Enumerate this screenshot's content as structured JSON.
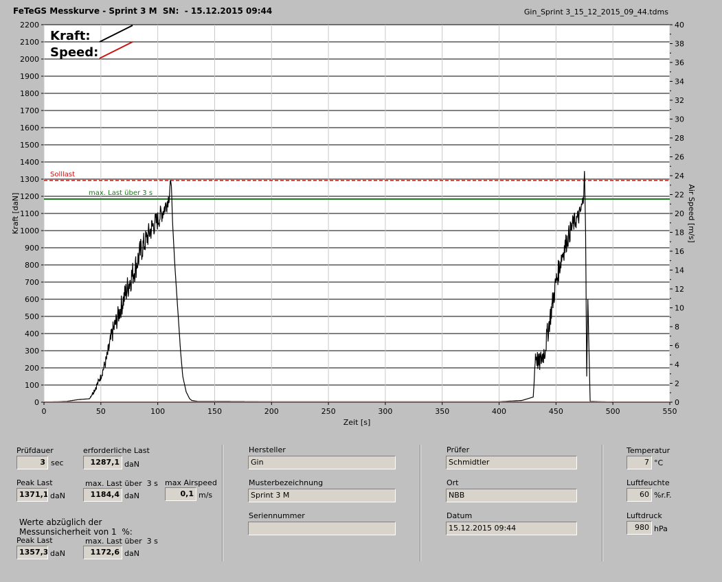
{
  "header": {
    "title": "FeTeGS Messkurve - Sprint 3 M  SN:  - 15.12.2015 09:44",
    "file": "Gin_Sprint 3_15_12_2015_09_44.tdms"
  },
  "chart_data": {
    "type": "line",
    "xlabel": "Zeit [s]",
    "ylabel": "Kraft [daN]",
    "y2label": "Air Speed [m/s]",
    "xlim": [
      0,
      550
    ],
    "ylim": [
      0,
      2200
    ],
    "y2lim": [
      0,
      40
    ],
    "x_ticks": [
      "0",
      "50",
      "100",
      "150",
      "200",
      "250",
      "300",
      "350",
      "400",
      "450",
      "500",
      "550"
    ],
    "y_ticks": [
      "0",
      "100",
      "200",
      "300",
      "400",
      "500",
      "600",
      "700",
      "800",
      "900",
      "1000",
      "1100",
      "1200",
      "1300",
      "1400",
      "1500",
      "1600",
      "1700",
      "1800",
      "1900",
      "2000",
      "2100",
      "2200"
    ],
    "y2_ticks": [
      "0",
      "2",
      "4",
      "6",
      "8",
      "10",
      "12",
      "14",
      "16",
      "18",
      "20",
      "22",
      "24",
      "26",
      "28",
      "30",
      "32",
      "34",
      "36",
      "38",
      "40"
    ],
    "grid": true,
    "legend": [
      {
        "name": "Kraft:",
        "color": "#000000"
      },
      {
        "name": "Speed:",
        "color": "#cc1111"
      }
    ],
    "annotations": [
      {
        "label": "Solllast",
        "y": 1292,
        "color": "#cc1111",
        "style": "dashed"
      },
      {
        "label": "max. Last über  3 s",
        "y": 1184,
        "color": "#1a7a1a",
        "style": "solid"
      }
    ],
    "series": [
      {
        "name": "Kraft",
        "color": "#000000",
        "x": [
          0,
          20,
          30,
          40,
          45,
          48,
          50,
          55,
          60,
          65,
          70,
          75,
          80,
          85,
          90,
          95,
          100,
          105,
          108,
          110,
          111,
          112,
          113,
          115,
          118,
          120,
          122,
          125,
          128,
          130,
          135,
          140,
          200,
          300,
          400,
          420,
          430,
          432,
          435,
          440,
          445,
          450,
          455,
          460,
          465,
          470,
          472,
          474,
          475,
          476,
          477,
          478,
          480,
          490,
          500
        ],
        "y": [
          0,
          5,
          15,
          20,
          80,
          120,
          150,
          250,
          400,
          500,
          600,
          700,
          780,
          880,
          950,
          1020,
          1060,
          1120,
          1160,
          1200,
          1280,
          1260,
          1050,
          800,
          500,
          300,
          150,
          60,
          20,
          10,
          5,
          5,
          3,
          3,
          3,
          10,
          30,
          280,
          220,
          300,
          500,
          700,
          850,
          950,
          1040,
          1080,
          1120,
          1180,
          1360,
          1000,
          150,
          600,
          5,
          3,
          0
        ],
        "noise": [
          0,
          0,
          0,
          0,
          20,
          20,
          20,
          40,
          60,
          60,
          70,
          80,
          80,
          80,
          70,
          70,
          60,
          60,
          50,
          40,
          30,
          0,
          0,
          0,
          0,
          0,
          0,
          0,
          0,
          0,
          0,
          0,
          0,
          0,
          0,
          0,
          0,
          60,
          60,
          70,
          70,
          70,
          70,
          60,
          60,
          50,
          50,
          50,
          20,
          0,
          0,
          0,
          0,
          0,
          0
        ]
      },
      {
        "name": "Speed",
        "color": "#ee8888",
        "x": [
          0,
          550
        ],
        "y": [
          0.05,
          0.05
        ]
      }
    ]
  },
  "panel": {
    "pruefdauer": {
      "label": "Prüfdauer",
      "value": "3",
      "unit": "sec"
    },
    "erforderliche_last": {
      "label": "erforderliche Last",
      "value": "1287,1",
      "unit": "daN"
    },
    "peak_last": {
      "label": "Peak Last",
      "value": "1371,1",
      "unit": "daN"
    },
    "max_last": {
      "label": "max. Last über  3 s",
      "value": "1184,4",
      "unit": "daN"
    },
    "max_airspeed": {
      "label": "max Airspeed",
      "value": "0,1",
      "unit": "m/s"
    },
    "note_line1": "Werte abzüglich der",
    "note_line2": "Messunsicherheit von 1  %:",
    "peak_last2": {
      "label": "Peak Last",
      "value": "1357,3",
      "unit": "daN"
    },
    "max_last2": {
      "label": "max. Last über  3 s",
      "value": "1172,6",
      "unit": "daN"
    },
    "hersteller": {
      "label": "Hersteller",
      "value": "Gin"
    },
    "musterbezeichnung": {
      "label": "Musterbezeichnung",
      "value": "Sprint 3 M"
    },
    "seriennummer": {
      "label": "Seriennummer",
      "value": ""
    },
    "pruefer": {
      "label": "Prüfer",
      "value": "Schmidtler"
    },
    "ort": {
      "label": "Ort",
      "value": "NBB"
    },
    "datum": {
      "label": "Datum",
      "value": "15.12.2015 09:44"
    },
    "temperatur": {
      "label": "Temperatur",
      "value": "7",
      "unit": "°C"
    },
    "luftfeuchte": {
      "label": "Luftfeuchte",
      "value": "60",
      "unit": "%r.F."
    },
    "luftdruck": {
      "label": "Luftdruck",
      "value": "980",
      "unit": "hPa"
    }
  }
}
